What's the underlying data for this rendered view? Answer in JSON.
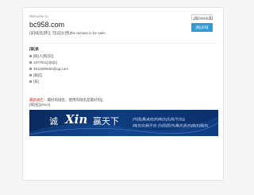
{
  "page": {
    "welcome": "Welcome to",
    "domain": "bc958.com",
    "sale_text": "[该]域[名]转让 可[议]价[售]the domain is for sale!",
    "lang_label": "[选]Select[语]",
    "buy_label": "[购]买域",
    "section_title": "[联]系",
    "contact": [
      {
        "label": "[联]人[购]买[]",
        "icon": "person-icon"
      },
      {
        "label": "1377511[3]5[0]",
        "icon": "phone-icon"
      },
      {
        "label": "4811590550@qq.com",
        "icon": "mail-icon"
      },
      {
        "label": "[微]信",
        "icon": "wechat-icon"
      },
      {
        "label": "[日]",
        "icon": "clock-icon"
      }
    ],
    "notice_warn": "最新通告",
    "notice_text": "：最好的域名，使用的域名是最好的[]",
    "notice_extra": "[域]名[]dn/cn]",
    "banner": {
      "left": "诚",
      "logo": "Xin",
      "right": "赢天下",
      "tagline_1": "[中]国[]最[诚]信[的]域[名]交[易]平[台][]",
      "tagline_2": "[域]名[交]易[平]台 [为]您[提]供[]最[优]质[的]域[名]服[务]"
    },
    "colors": {
      "accent": "#2e9ad6",
      "warning": "#e02020",
      "banner_dark": "#0a2a5e"
    }
  }
}
